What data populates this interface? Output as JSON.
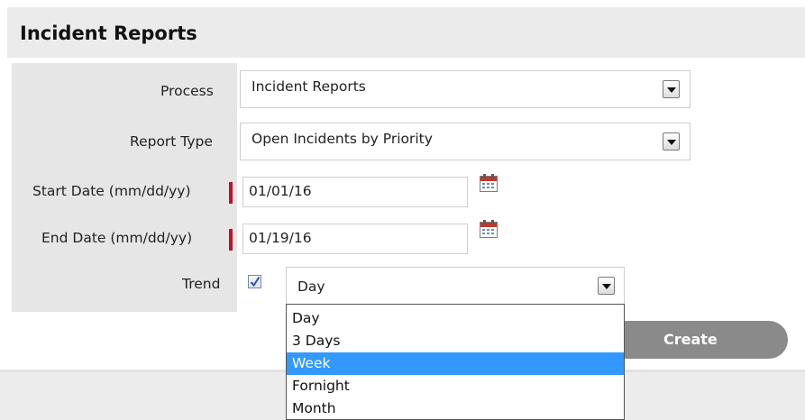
{
  "page": {
    "title": "Incident Reports"
  },
  "form": {
    "process": {
      "label": "Process",
      "value": "Incident Reports"
    },
    "report_type": {
      "label": "Report Type",
      "value": "Open Incidents by Priority"
    },
    "start_date": {
      "label": "Start Date (mm/dd/yy)",
      "value": "01/01/16",
      "required": true
    },
    "end_date": {
      "label": "End Date (mm/dd/yy)",
      "value": "01/19/16",
      "required": true
    },
    "trend": {
      "label": "Trend",
      "checked": true,
      "value": "Day",
      "options": [
        "Day",
        "3 Days",
        "Week",
        "Fornight",
        "Month"
      ],
      "highlighted_option": "Week"
    }
  },
  "actions": {
    "create_label": "Create"
  },
  "icons": {
    "calendar": "calendar-icon",
    "dropdown": "chevron-down-icon",
    "check": "checkmark-icon"
  },
  "colors": {
    "required_marker": "#c0102a",
    "highlight": "#3399ff",
    "create_button": "#8a8a8a"
  }
}
